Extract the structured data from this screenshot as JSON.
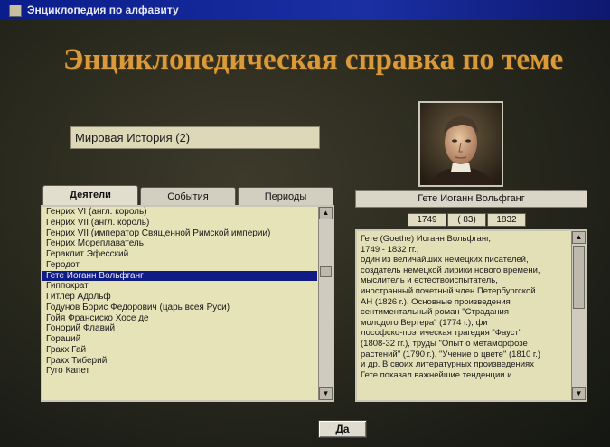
{
  "window": {
    "title": "Энциклопедия по алфавиту"
  },
  "header": {
    "heading": "Энциклопедическая справка по теме"
  },
  "topic": {
    "value": "Мировая История (2)"
  },
  "tabs": [
    {
      "label": "Деятели",
      "active": true
    },
    {
      "label": "События",
      "active": false
    },
    {
      "label": "Периоды",
      "active": false
    }
  ],
  "list": {
    "items": [
      "Генрих VI (англ. король)",
      "Генрих VII (англ. король)",
      "Генрих VII (император Священной Римской империи)",
      "Генрих Мореплаватель",
      "Гераклит Эфесский",
      "Геродот",
      "Гете Иоганн Вольфганг",
      "Гиппократ",
      "Гитлер Адольф",
      "Годунов Борис Федорович (царь всея Руси)",
      "Гойя Франсиско Хосе де",
      "Гонорий Флавий",
      "Гораций",
      "Гракх Гай",
      "Гракх Тиберий",
      "Гуго Капет"
    ],
    "selected_index": 6
  },
  "person": {
    "name": "Гете Иоганн Вольфганг",
    "birth": "1749",
    "age": "( 83)",
    "death": "1832"
  },
  "description": {
    "lines": [
      "Гете (Goethe) Иоганн Вольфганг,",
      "1749 - 1832 гг.,",
      "один из величайших немецких писателей,",
      "создатель немецкой лирики нового времени,",
      "мыслитель и естествоиспытатель,",
      "иностранный почетный член Петербургской",
      "АН (1826 г.). Основные произведения",
      "сентиментальный роман \"Страдания",
      "молодого Вертера\" (1774 г.), фи",
      "лософско-поэтическая трагедия \"Фауст\"",
      "(1808-32 гг.), труды \"Опыт о метаморфозе",
      "растений\" (1790 г.), \"Учение о цвете\" (1810 г.)",
      "и др. В своих литературных произведениях",
      "Гете показал важнейшие тенденции и"
    ]
  },
  "buttons": {
    "ok": "Да"
  }
}
